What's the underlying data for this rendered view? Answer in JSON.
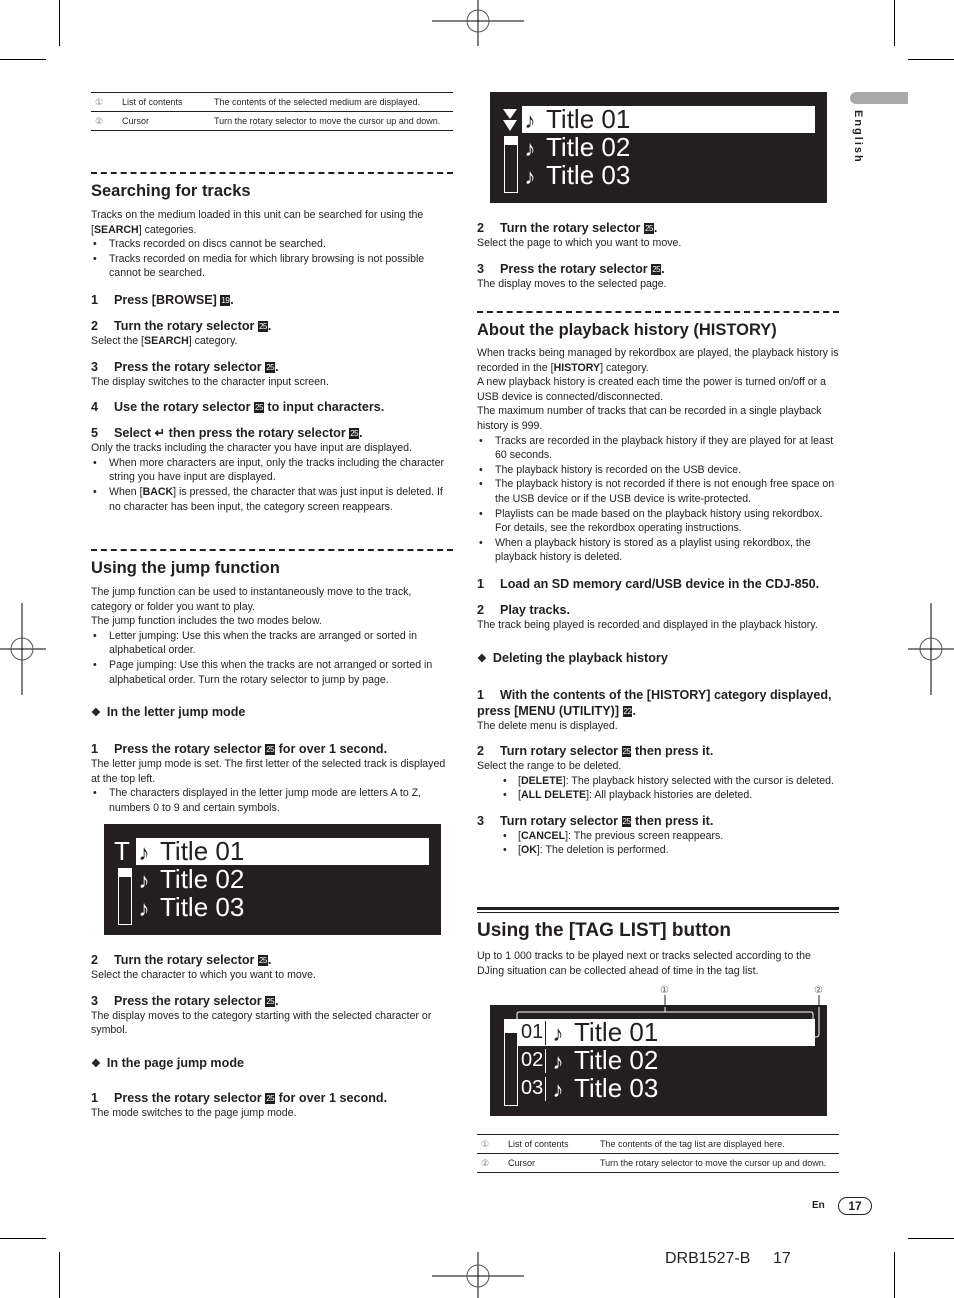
{
  "side_tab": {
    "language": "English"
  },
  "top_table": {
    "rows": [
      {
        "marker": "①",
        "item": "List of contents",
        "description": "The contents of the selected medium are displayed."
      },
      {
        "marker": "②",
        "item": "Cursor",
        "description": "Turn the rotary selector to move the cursor up and down."
      }
    ]
  },
  "searching": {
    "heading": "Searching for tracks",
    "intro_pre": "Tracks on the medium loaded in this unit can be searched for using the [",
    "intro_bold": "SEARCH",
    "intro_post": "] categories.",
    "bullets": [
      "Tracks recorded on discs cannot be searched.",
      "Tracks recorded on media for which library browsing is not possible cannot be searched."
    ],
    "steps": [
      {
        "num": "1",
        "text": "Press [BROWSE]",
        "badge": "19",
        "after": ".",
        "desc": ""
      },
      {
        "num": "2",
        "text": "Turn the rotary selector",
        "badge": "25",
        "after": ".",
        "desc_pre": "Select the [",
        "desc_bold": "SEARCH",
        "desc_post": "] category."
      },
      {
        "num": "3",
        "text": "Press the rotary selector",
        "badge": "25",
        "after": ".",
        "desc": "The display switches to the character input screen."
      },
      {
        "num": "4",
        "text": "Use the rotary selector",
        "badge": "25",
        "after": " to input characters.",
        "desc": ""
      },
      {
        "num": "5",
        "text": "Select ↵ then press the rotary selector",
        "badge": "25",
        "after": ".",
        "desc": "Only the tracks including the character you have input are displayed."
      }
    ],
    "step5_bullets": [
      {
        "pre": "When more characters are input, only the tracks including the character string you have input are displayed.",
        "bold": "",
        "post": ""
      },
      {
        "pre": "When [",
        "bold": "BACK",
        "post": "] is pressed, the character that was just input is deleted. If no character has been input, the category screen reappears."
      }
    ]
  },
  "jump": {
    "heading": "Using the jump function",
    "intro": [
      "The jump function can be used to instantaneously move to the track, category or folder you want to play.",
      "The jump function includes the two modes below."
    ],
    "bullets": [
      "Letter jumping: Use this when the tracks are arranged or sorted in alphabetical order.",
      "Page jumping: Use this when the tracks are not arranged or sorted in alphabetical order. Turn the rotary selector to jump by page."
    ],
    "letter_mode": {
      "heading": "In the letter jump mode",
      "step1": {
        "num": "1",
        "text": "Press the rotary selector",
        "badge": "25",
        "after": " for over 1 second.",
        "desc": "The letter jump mode is set. The first letter of the selected track is displayed at the top left."
      },
      "step1_bullet": "The characters displayed in the letter jump mode are letters A to Z, numbers 0 to 9 and certain symbols.",
      "screen": {
        "indicator": "T",
        "titles": [
          "Title 01",
          "Title 02",
          "Title 03"
        ],
        "scroll_position": 0.15
      },
      "step2": {
        "num": "2",
        "text": "Turn the rotary selector",
        "badge": "25",
        "after": ".",
        "desc": "Select the character to which you want to move."
      },
      "step3": {
        "num": "3",
        "text": "Press the rotary selector",
        "badge": "25",
        "after": ".",
        "desc": "The display moves to the category starting with the selected character or symbol."
      }
    },
    "page_mode": {
      "heading": "In the page jump mode",
      "step1": {
        "num": "1",
        "text": "Press the rotary selector",
        "badge": "25",
        "after": " for over 1 second.",
        "desc": "The mode switches to the page jump mode."
      },
      "screen": {
        "titles": [
          "Title 01",
          "Title 02",
          "Title 03"
        ],
        "scroll_position": 0.15
      },
      "step2": {
        "num": "2",
        "text": "Turn the rotary selector",
        "badge": "25",
        "after": ".",
        "desc": "Select the page to which you want to move."
      },
      "step3": {
        "num": "3",
        "text": "Press the rotary selector",
        "badge": "25",
        "after": ".",
        "desc": "The display moves to the selected page."
      }
    }
  },
  "history": {
    "heading": "About the playback history (HISTORY)",
    "p1_pre": "When tracks being managed by rekordbox are played, the playback history is recorded in the [",
    "p1_bold": "HISTORY",
    "p1_post": "] category.",
    "p2": "A new playback history is created each time the power is turned on/off or a USB device is connected/disconnected.",
    "p3": "The maximum number of tracks that can be recorded in a single playback history is 999.",
    "bullets": [
      "Tracks are recorded in the playback history if they are played for at least 60 seconds.",
      "The playback history is recorded on the USB device.",
      "The playback history is not recorded if there is not enough free space on the USB device or if the USB device is write-protected.",
      "Playlists can be made based on the playback history using rekordbox. For details, see the rekordbox operating instructions.",
      "When a playback history is stored as a playlist using rekordbox, the playback history is deleted."
    ],
    "step1": {
      "num": "1",
      "text": "Load an SD memory card/USB device in the CDJ-850."
    },
    "step2": {
      "num": "2",
      "text": "Play tracks.",
      "desc": "The track being played is recorded and displayed in the playback history."
    },
    "deleting": {
      "heading": "Deleting the playback history",
      "step1": {
        "num": "1",
        "text": "With the contents of the [HISTORY] category displayed, press [MENU (UTILITY)]",
        "badge": "22",
        "after": ".",
        "desc": "The delete menu is displayed."
      },
      "step2": {
        "num": "2",
        "text": "Turn rotary selector",
        "badge": "25",
        "after": " then press it.",
        "desc": "Select the range to be deleted."
      },
      "step2_bullets": [
        {
          "bold": "DELETE",
          "post": "]: The playback history selected with the cursor is deleted."
        },
        {
          "bold": "ALL DELETE",
          "post": "]: All playback histories are deleted."
        }
      ],
      "step3": {
        "num": "3",
        "text": "Turn rotary selector",
        "badge": "25",
        "after": " then press it."
      },
      "step3_bullets": [
        {
          "bold": "CANCEL",
          "post": "]: The previous screen reappears."
        },
        {
          "bold": "OK",
          "post": "]: The deletion is performed."
        }
      ]
    }
  },
  "taglist": {
    "heading": "Using the [TAG LIST] button",
    "intro": "Up to 1 000 tracks to be played next or tracks selected according to the DJing situation can be collected ahead of time in the tag list.",
    "callouts": [
      "①",
      "②"
    ],
    "screen": {
      "rows": [
        {
          "num": "01",
          "title": "Title 01"
        },
        {
          "num": "02",
          "title": "Title 02"
        },
        {
          "num": "03",
          "title": "Title 03"
        }
      ],
      "scroll_position": 0.15
    },
    "table": {
      "rows": [
        {
          "marker": "①",
          "item": "List of contents",
          "description": "The contents of the tag list are displayed here."
        },
        {
          "marker": "②",
          "item": "Cursor",
          "description": "Turn the rotary selector to move the cursor up and down."
        }
      ]
    }
  },
  "footer": {
    "lang": "En",
    "page": "17",
    "doc_code": "DRB1527-B",
    "print_page": "17"
  }
}
